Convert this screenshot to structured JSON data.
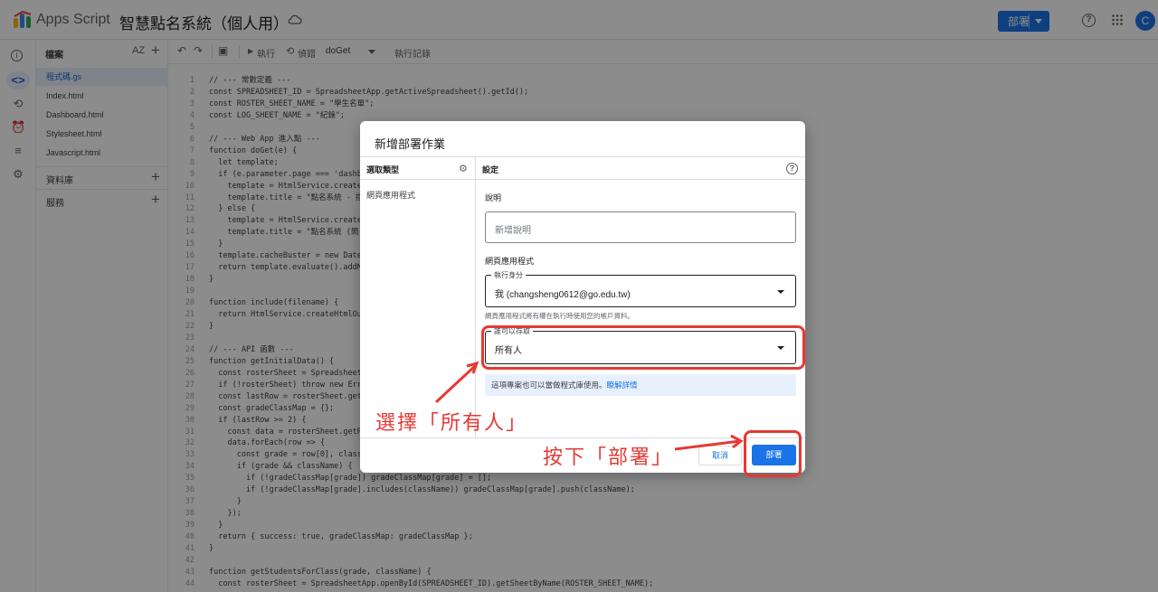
{
  "topbar": {
    "app_name": "Apps Script",
    "project_name": "智慧點名系統（個人用）",
    "deploy_label": "部署",
    "avatar_initial": "C"
  },
  "files_panel": {
    "header": "檔案",
    "sort_label": "AZ",
    "files": [
      "程式碼.gs",
      "Index.html",
      "Dashboard.html",
      "Stylesheet.html",
      "Javascript.html"
    ],
    "libraries_label": "資料庫",
    "services_label": "服務"
  },
  "toolbar": {
    "run_label": "執行",
    "debug_label": "偵錯",
    "function_selected": "doGet",
    "log_label": "執行記錄"
  },
  "code": [
    {
      "n": "1",
      "t": "// --- 常數定義 ---"
    },
    {
      "n": "2",
      "t": "const SPREADSHEET_ID = SpreadsheetApp.getActiveSpreadsheet().getId();"
    },
    {
      "n": "3",
      "t": "const ROSTER_SHEET_NAME = \"學生名單\";"
    },
    {
      "n": "4",
      "t": "const LOG_SHEET_NAME = \"紀錄\";"
    },
    {
      "n": "5",
      "t": ""
    },
    {
      "n": "6",
      "t": "// --- Web App 進入點 ---"
    },
    {
      "n": "7",
      "t": "function doGet(e) {"
    },
    {
      "n": "8",
      "t": "  let template;"
    },
    {
      "n": "9",
      "t": "  if (e.parameter.page === 'dashbo"
    },
    {
      "n": "10",
      "t": "    template = HtmlService.create"
    },
    {
      "n": "11",
      "t": "    template.title = \"點名系統 - 指"
    },
    {
      "n": "12",
      "t": "  } else {"
    },
    {
      "n": "13",
      "t": "    template = HtmlService.create"
    },
    {
      "n": "14",
      "t": "    template.title = \"點名系統 (簡"
    },
    {
      "n": "15",
      "t": "  }"
    },
    {
      "n": "16",
      "t": "  template.cacheBuster = new Date"
    },
    {
      "n": "17",
      "t": "  return template.evaluate().addM"
    },
    {
      "n": "18",
      "t": "}"
    },
    {
      "n": "19",
      "t": ""
    },
    {
      "n": "20",
      "t": "function include(filename) {"
    },
    {
      "n": "21",
      "t": "  return HtmlService.createHtmlOu"
    },
    {
      "n": "22",
      "t": "}"
    },
    {
      "n": "23",
      "t": ""
    },
    {
      "n": "24",
      "t": "// --- API 函數 ---"
    },
    {
      "n": "25",
      "t": "function getInitialData() {"
    },
    {
      "n": "26",
      "t": "  const rosterSheet = Spreadsheet"
    },
    {
      "n": "27",
      "t": "  if (!rosterSheet) throw new Err"
    },
    {
      "n": "28",
      "t": "  const lastRow = rosterSheet.get"
    },
    {
      "n": "29",
      "t": "  const gradeClassMap = {};"
    },
    {
      "n": "30",
      "t": "  if (lastRow >= 2) {"
    },
    {
      "n": "31",
      "t": "    const data = rosterSheet.getR"
    },
    {
      "n": "32",
      "t": "    data.forEach(row => {"
    },
    {
      "n": "33",
      "t": "      const grade = row[0], class"
    },
    {
      "n": "34",
      "t": "      if (grade && className) {"
    },
    {
      "n": "35",
      "t": "        if (!gradeClassMap[grade]) gradeClassMap[grade] = [];"
    },
    {
      "n": "36",
      "t": "        if (!gradeClassMap[grade].includes(className)) gradeClassMap[grade].push(className);"
    },
    {
      "n": "37",
      "t": "      }"
    },
    {
      "n": "38",
      "t": "    });"
    },
    {
      "n": "39",
      "t": "  }"
    },
    {
      "n": "40",
      "t": "  return { success: true, gradeClassMap: gradeClassMap };"
    },
    {
      "n": "41",
      "t": "}"
    },
    {
      "n": "42",
      "t": ""
    },
    {
      "n": "43",
      "t": "function getStudentsForClass(grade, className) {"
    },
    {
      "n": "44",
      "t": "  const rosterSheet = SpreadsheetApp.openById(SPREADSHEET_ID).getSheetByName(ROSTER_SHEET_NAME);"
    }
  ],
  "dialog": {
    "title": "新增部署作業",
    "type_header": "選取類型",
    "settings_header": "設定",
    "type_item": "網頁應用程式",
    "description_label": "說明",
    "description_placeholder": "新增說明",
    "webapp_label": "網頁應用程式",
    "execute_as_legend": "執行身分",
    "execute_as_value": "我 (changsheng0612@go.edu.tw)",
    "execute_hint": "網頁應用程式將有權在執行時使用您的帳戶資料。",
    "access_legend": "誰可以存取",
    "access_value": "所有人",
    "info_text": "這項專案也可以當做程式庫使用。",
    "info_link": "瞭解詳情",
    "cancel_label": "取消",
    "deploy_label": "部署"
  },
  "annotations": {
    "select_everyone": "選擇「所有人」",
    "press_deploy": "按下「部署」",
    "color": "#e53935"
  }
}
